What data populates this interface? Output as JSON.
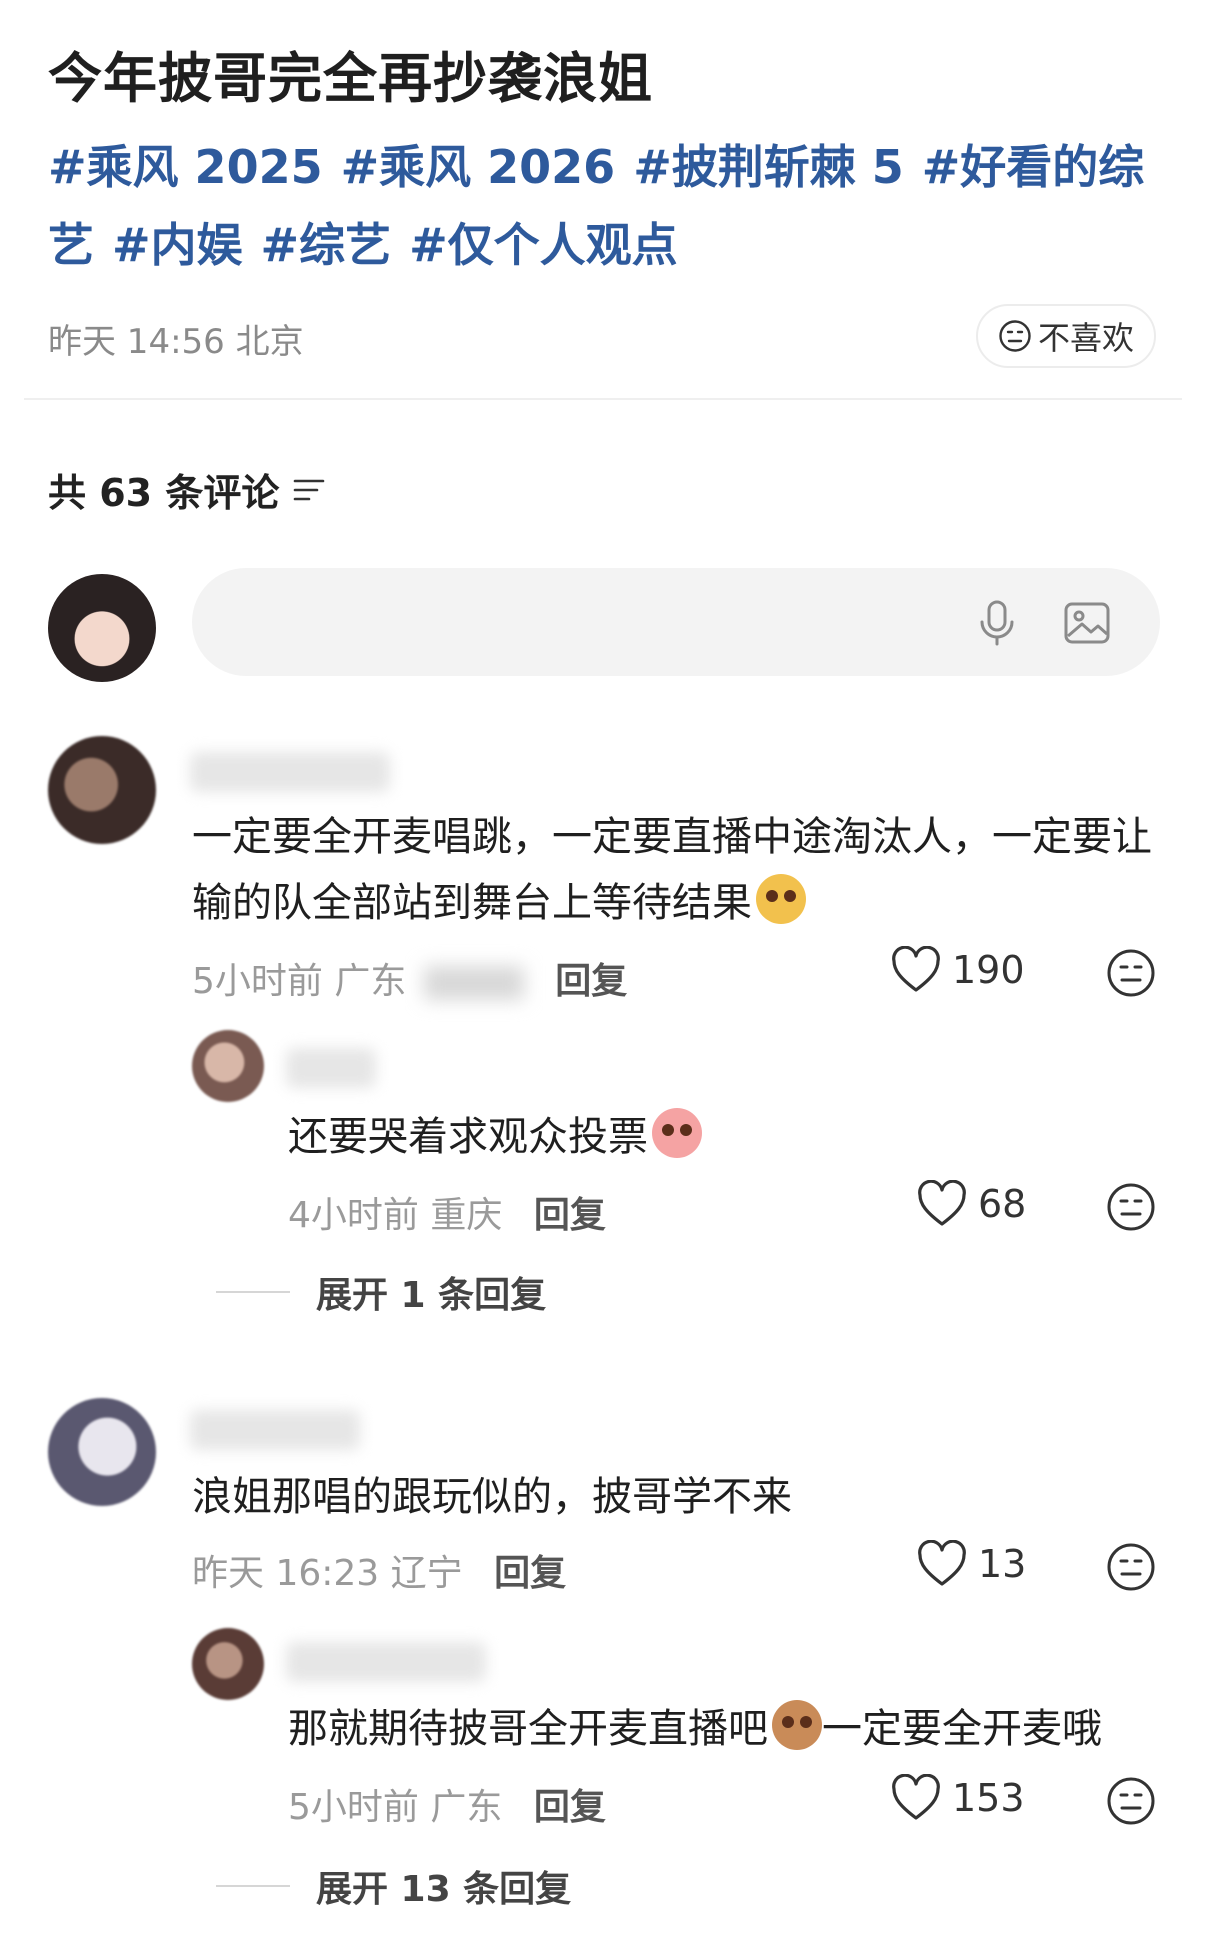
{
  "post": {
    "title": "今年披哥完全再抄袭浪姐",
    "tags": [
      "#乘风 2025",
      "#乘风 2026",
      "#披荆斩棘 5",
      "#好看的综艺",
      "#内娱",
      "#综艺",
      "#仅个人观点"
    ],
    "time": "昨天 14:56 北京",
    "dislike_label": "不喜欢"
  },
  "comments_header": {
    "count_label": "共 63 条评论"
  },
  "input": {
    "placeholder": ""
  },
  "comments": [
    {
      "text": "一定要全开麦唱跳，一定要直播中途淘汰人，一定要让输的队全部站到舞台上等待结果",
      "emoji": "dog-emoji",
      "time": "5小时前",
      "location": "广东",
      "reply_label": "回复",
      "likes": "190",
      "replies": [
        {
          "text": "还要哭着求观众投票",
          "emoji": "peach-emoji",
          "time": "4小时前",
          "location": "重庆",
          "reply_label": "回复",
          "likes": "68"
        }
      ],
      "expand_label": "展开 1 条回复"
    },
    {
      "text": "浪姐那唱的跟玩似的，披哥学不来",
      "time": "昨天 16:23",
      "location": "辽宁",
      "reply_label": "回复",
      "likes": "13",
      "replies": [
        {
          "text_before": "那就期待披哥全开麦直播吧",
          "emoji": "puppy-emoji",
          "text_after": "一定要全开麦哦",
          "time": "5小时前",
          "location": "广东",
          "reply_label": "回复",
          "likes": "153"
        }
      ],
      "expand_label": "展开 13 条回复"
    }
  ],
  "colors": {
    "hashtag": "#2e5a9c",
    "meta": "#9a9a9a",
    "input_bg": "#f3f3f3"
  }
}
